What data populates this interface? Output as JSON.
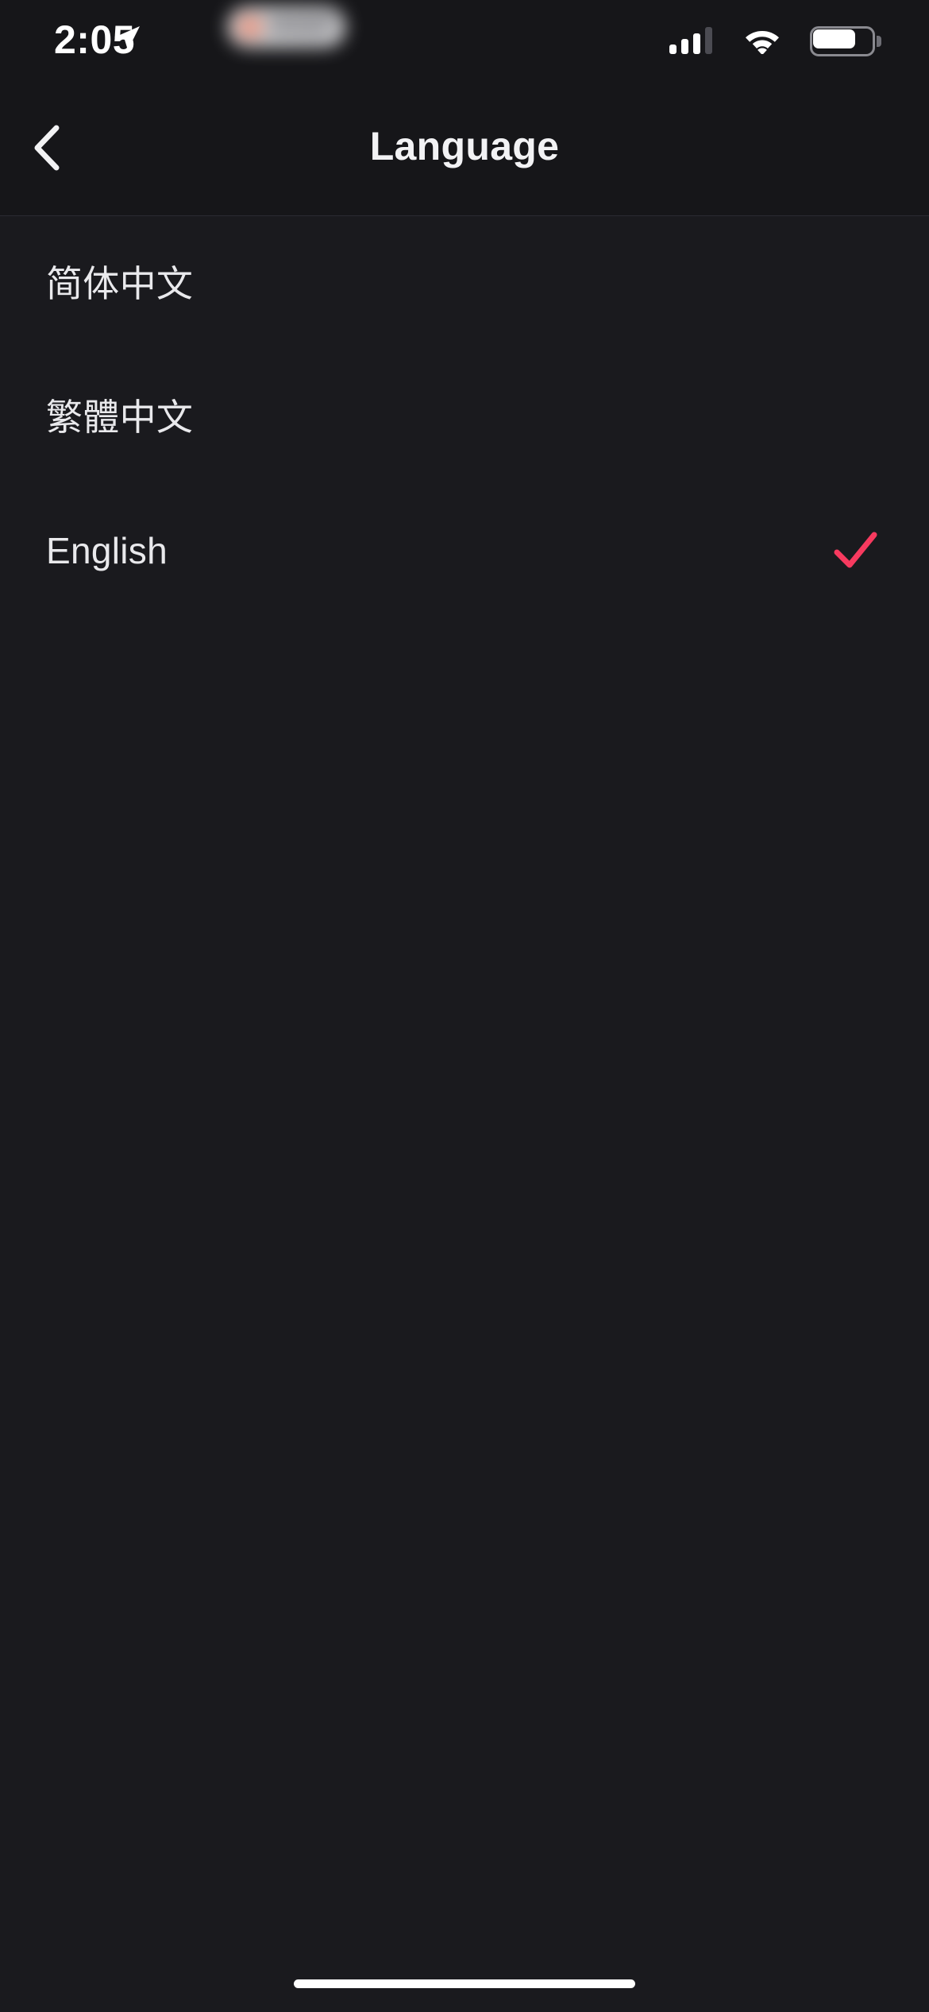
{
  "status_bar": {
    "time": "2:05",
    "location_icon": "location-arrow-icon",
    "dynamic_island": "blurred-activity-pill",
    "signal_icon": "cellular-signal-icon",
    "signal_bars_active": 3,
    "signal_bars_total": 4,
    "wifi_icon": "wifi-icon",
    "battery_icon": "battery-icon",
    "battery_level_percent": 70
  },
  "nav_bar": {
    "back_icon": "chevron-left-icon",
    "title": "Language"
  },
  "list": {
    "items": [
      {
        "label": "简体中文",
        "selected": false
      },
      {
        "label": "繁體中文",
        "selected": false
      },
      {
        "label": "English",
        "selected": true
      }
    ]
  },
  "colors": {
    "background": "#1a1a1e",
    "bar_background": "#161619",
    "divider": "#2b2b31",
    "text_primary": "#e9e9ec",
    "accent_check": "#f73a5f"
  },
  "home_indicator": "home-indicator-bar"
}
